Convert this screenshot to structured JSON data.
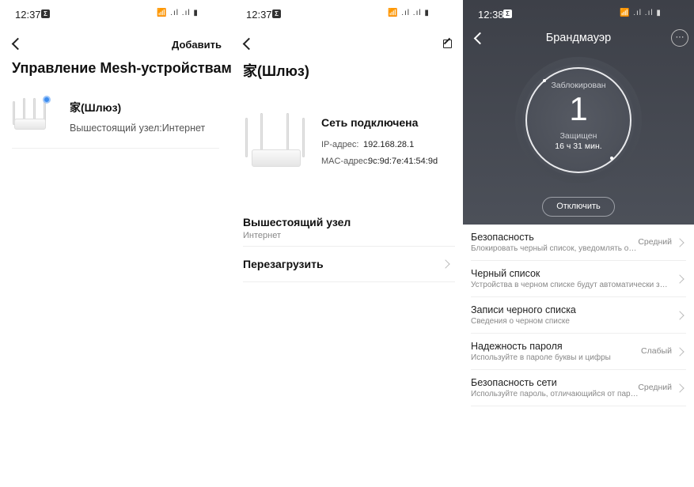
{
  "panel1": {
    "status": {
      "time": "12:37",
      "sys_icons": "📶 .ıl .ıl ▮"
    },
    "add_label": "Добавить",
    "title": "Управление Mesh-устройствами",
    "device": {
      "name": "家(Шлюз)",
      "upstream": "Вышестоящий узел:Интернет"
    }
  },
  "panel2": {
    "status": {
      "time": "12:37",
      "sys_icons": "📶 .ıl .ıl ▮"
    },
    "title": "家(Шлюз)",
    "network_status": "Сеть подключена",
    "ip_label": "IP-адрес:",
    "ip_value": "192.168.28.1",
    "mac_label": "MAC-адрес:",
    "mac_value": "9c:9d:7e:41:54:9d",
    "upstream_title": "Вышестоящий узел",
    "upstream_value": "Интернет",
    "reboot_label": "Перезагрузить"
  },
  "panel3": {
    "status": {
      "time": "12:38",
      "sys_icons": "📶 .ıl .ıl ▮"
    },
    "title": "Брандмауэр",
    "more_label": "···",
    "blocked_label": "Заблокирован",
    "blocked_count": "1",
    "protected_label": "Защищен",
    "protected_time": "16 ч 31 мин.",
    "disable_label": "Отключить",
    "items": [
      {
        "title": "Безопасность",
        "subtitle": "Блокировать черный список, уведомлять о…",
        "value": "Средний"
      },
      {
        "title": "Черный список",
        "subtitle": "Устройства в черном списке будут автоматически з…",
        "value": ""
      },
      {
        "title": "Записи черного списка",
        "subtitle": "Сведения о черном списке",
        "value": ""
      },
      {
        "title": "Надежность пароля",
        "subtitle": "Используйте в пароле буквы и цифры",
        "value": "Слабый"
      },
      {
        "title": "Безопасность сети",
        "subtitle": "Используйте пароль, отличающийся от пар…",
        "value": "Средний"
      }
    ]
  }
}
